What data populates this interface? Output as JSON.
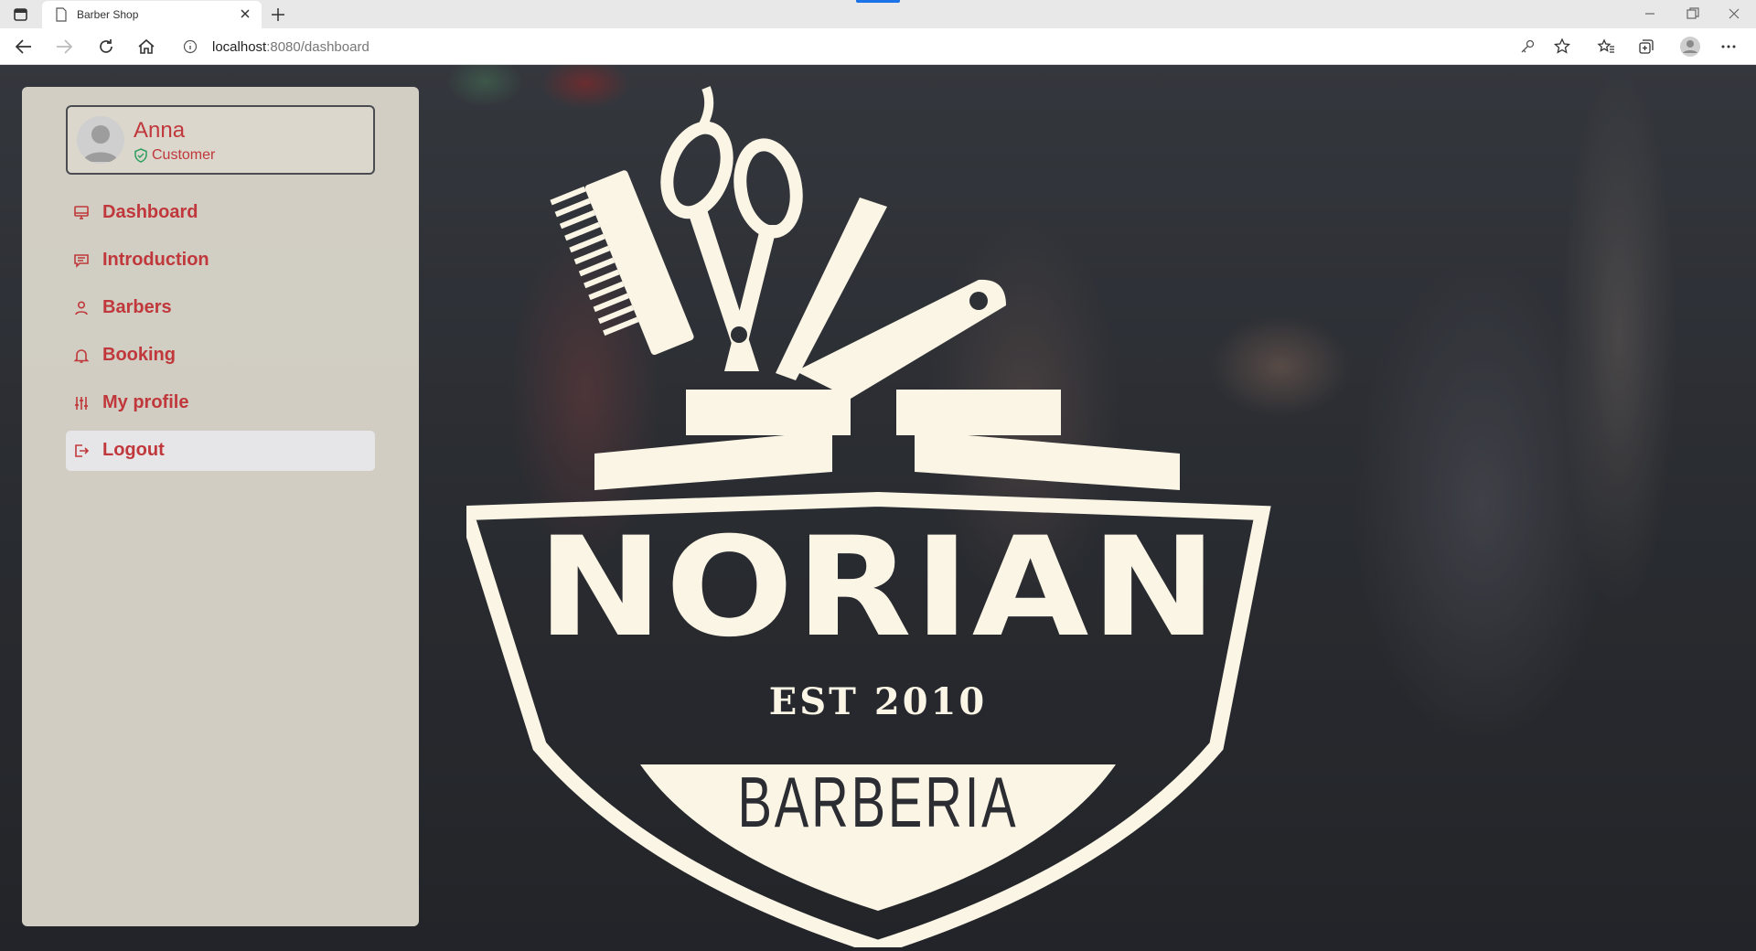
{
  "browser": {
    "tab_title": "Barber Shop",
    "url_host": "localhost",
    "url_path": ":8080/dashboard"
  },
  "user": {
    "name": "Anna",
    "role": "Customer"
  },
  "menu": [
    {
      "label": "Dashboard",
      "icon": "monitor-icon"
    },
    {
      "label": "Introduction",
      "icon": "message-icon"
    },
    {
      "label": "Barbers",
      "icon": "person-icon"
    },
    {
      "label": "Booking",
      "icon": "bell-icon"
    },
    {
      "label": "My profile",
      "icon": "sliders-icon"
    },
    {
      "label": "Logout",
      "icon": "logout-icon",
      "active": true
    }
  ],
  "logo": {
    "title": "NORIAN",
    "established": "EST 2010",
    "subtitle": "BARBERIA"
  },
  "colors": {
    "accent": "#c0383b",
    "logo_cream": "#fbf5e6",
    "sidebar_bg": "#dcd8cc"
  }
}
